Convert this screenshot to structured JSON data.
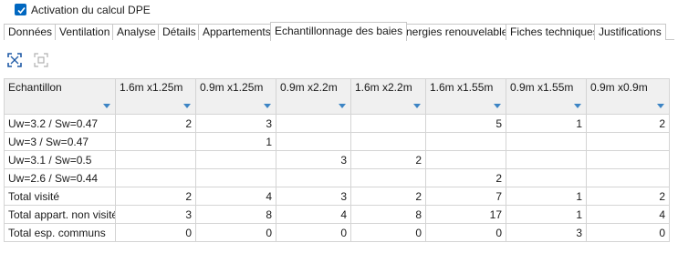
{
  "activation": {
    "checked": true,
    "label": "Activation du calcul DPE"
  },
  "tabs": [
    {
      "label": "Données"
    },
    {
      "label": "Ventilation"
    },
    {
      "label": "Analyse"
    },
    {
      "label": "Détails"
    },
    {
      "label": "Appartements"
    },
    {
      "label": "Echantillonnage des baies",
      "active": true
    },
    {
      "label": "Energies renouvelables"
    },
    {
      "label": "Fiches techniques"
    },
    {
      "label": "Justifications"
    }
  ],
  "toolbar": {
    "icons": [
      "expand-icon",
      "collapse-icon"
    ]
  },
  "table": {
    "headers": [
      "Echantillon",
      "1.6m x1.25m",
      "0.9m x1.25m",
      "0.9m x2.2m",
      "1.6m x2.2m",
      "1.6m x1.55m",
      "0.9m x1.55m",
      "0.9m x0.9m"
    ],
    "rows": [
      [
        "Uw=3.2 / Sw=0.47",
        "2",
        "3",
        "",
        "",
        "5",
        "1",
        "2"
      ],
      [
        "Uw=3 / Sw=0.47",
        "",
        "1",
        "",
        "",
        "",
        "",
        ""
      ],
      [
        "Uw=3.1 / Sw=0.5",
        "",
        "",
        "3",
        "2",
        "",
        "",
        ""
      ],
      [
        "Uw=2.6 / Sw=0.44",
        "",
        "",
        "",
        "",
        "2",
        "",
        ""
      ],
      [
        "Total visité",
        "2",
        "4",
        "3",
        "2",
        "7",
        "1",
        "2"
      ],
      [
        "Total appart. non visité",
        "3",
        "8",
        "4",
        "8",
        "17",
        "1",
        "4"
      ],
      [
        "Total esp. communs",
        "0",
        "0",
        "0",
        "0",
        "0",
        "3",
        "0"
      ]
    ]
  },
  "colors": {
    "accent": "#0067c0",
    "filter": "#3c84c4",
    "header_bg": "#f0f0f0",
    "grid_line": "#d4d4d4"
  }
}
